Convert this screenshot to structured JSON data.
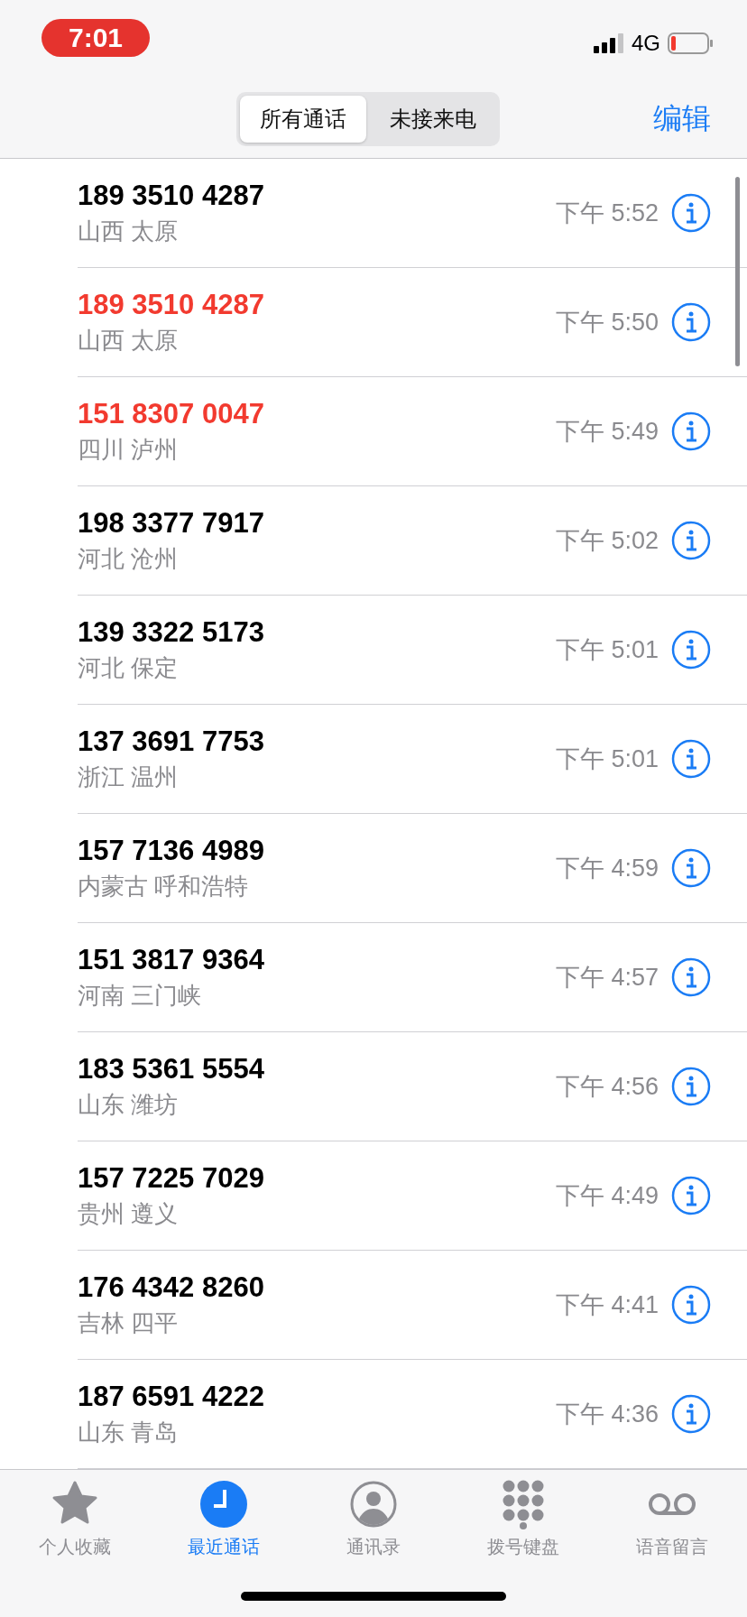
{
  "status_bar": {
    "time": "7:01",
    "network": "4G"
  },
  "nav": {
    "segments": [
      {
        "label": "所有通话",
        "selected": true
      },
      {
        "label": "未接来电",
        "selected": false
      }
    ],
    "edit": "编辑"
  },
  "calls": [
    {
      "number": "189 3510 4287",
      "location": "山西 太原",
      "time": "下午 5:52",
      "missed": false
    },
    {
      "number": "189 3510 4287",
      "location": "山西 太原",
      "time": "下午 5:50",
      "missed": true
    },
    {
      "number": "151 8307 0047",
      "location": "四川 泸州",
      "time": "下午 5:49",
      "missed": true
    },
    {
      "number": "198 3377 7917",
      "location": "河北 沧州",
      "time": "下午 5:02",
      "missed": false
    },
    {
      "number": "139 3322 5173",
      "location": "河北 保定",
      "time": "下午 5:01",
      "missed": false
    },
    {
      "number": "137 3691 7753",
      "location": "浙江 温州",
      "time": "下午 5:01",
      "missed": false
    },
    {
      "number": "157 7136 4989",
      "location": "内蒙古 呼和浩特",
      "time": "下午 4:59",
      "missed": false
    },
    {
      "number": "151 3817 9364",
      "location": "河南 三门峡",
      "time": "下午 4:57",
      "missed": false
    },
    {
      "number": "183 5361 5554",
      "location": "山东 潍坊",
      "time": "下午 4:56",
      "missed": false
    },
    {
      "number": "157 7225 7029",
      "location": "贵州 遵义",
      "time": "下午 4:49",
      "missed": false
    },
    {
      "number": "176 4342 8260",
      "location": "吉林 四平",
      "time": "下午 4:41",
      "missed": false
    },
    {
      "number": "187 6591 4222",
      "location": "山东 青岛",
      "time": "下午 4:36",
      "missed": false
    }
  ],
  "tab_bar": [
    {
      "kind": "favorites",
      "label": "个人收藏",
      "selected": false
    },
    {
      "kind": "recents",
      "label": "最近通话",
      "selected": true
    },
    {
      "kind": "contacts",
      "label": "通讯录",
      "selected": false
    },
    {
      "kind": "keypad",
      "label": "拨号键盘",
      "selected": false
    },
    {
      "kind": "voicemail",
      "label": "语音留言",
      "selected": false
    }
  ]
}
